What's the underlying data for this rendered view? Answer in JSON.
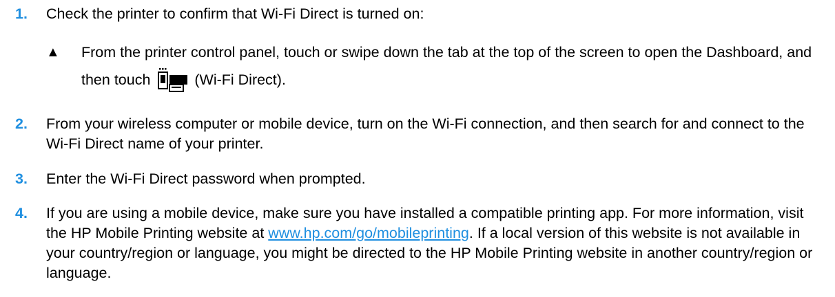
{
  "steps": [
    {
      "number": "1.",
      "text": "Check the printer to confirm that Wi-Fi Direct is turned on:",
      "substep": {
        "marker": "▲",
        "text_before_icon": "From the printer control panel, touch or swipe down the tab at the top of the screen to open the Dashboard, and then touch ",
        "icon": "wifi-direct-icon",
        "text_after_icon": " (Wi-Fi Direct)."
      }
    },
    {
      "number": "2.",
      "text": "From your wireless computer or mobile device, turn on the Wi-Fi connection, and then search for and connect to the Wi-Fi Direct name of your printer."
    },
    {
      "number": "3.",
      "text": "Enter the Wi-Fi Direct password when prompted."
    },
    {
      "number": "4.",
      "text_before_link": "If you are using a mobile device, make sure you have installed a compatible printing app. For more information, visit the HP Mobile Printing website at ",
      "link": "www.hp.com/go/mobileprinting",
      "text_after_link": ". If a local version of this website is not available in your country/region or language, you might be directed to the HP Mobile Printing website in another country/region or language."
    }
  ],
  "colors": {
    "step_number": "#1f8fe0",
    "link": "#1f8fe0"
  }
}
